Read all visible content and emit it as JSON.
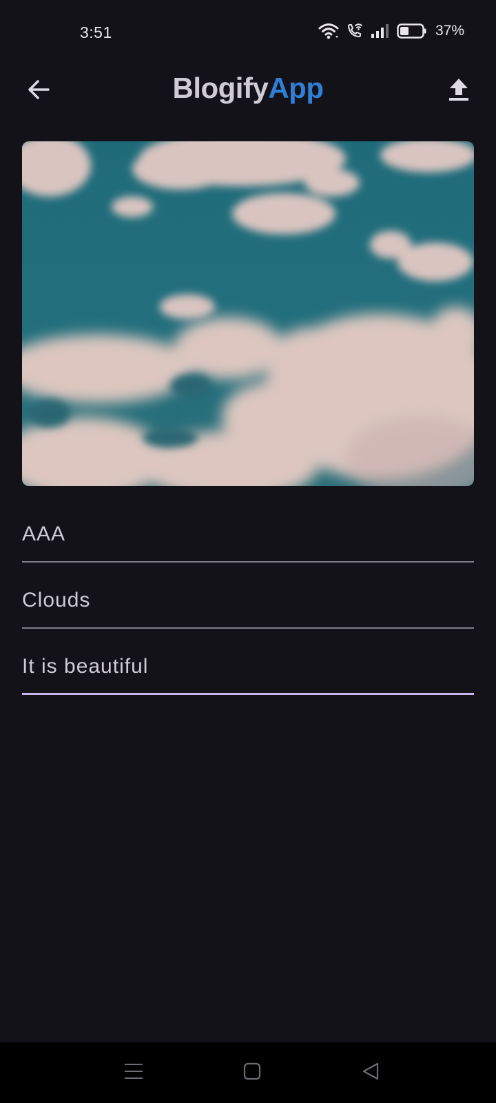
{
  "status_bar": {
    "time": "3:51",
    "battery": "37%",
    "icons": [
      "wifi-icon",
      "wifi-call-icon",
      "signal-icon",
      "battery-icon"
    ]
  },
  "app_bar": {
    "title_part1": "Blogify",
    "title_part2": "App",
    "back_icon": "arrow-back-icon",
    "upload_icon": "upload-icon",
    "accent_color": "#2f7fd6"
  },
  "form": {
    "fields": [
      {
        "value": "AAA",
        "focused": false
      },
      {
        "value": "Clouds",
        "focused": false
      },
      {
        "value": "It is beautiful",
        "focused": true
      }
    ],
    "focus_color": "#c6b8ea"
  },
  "nav_bar": {
    "icons": [
      "menu-icon",
      "home-icon",
      "back-triangle-icon"
    ]
  }
}
